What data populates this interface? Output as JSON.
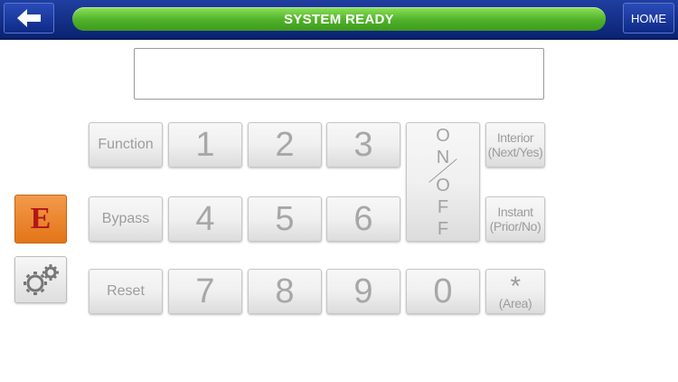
{
  "header": {
    "back_icon": "arrow-left-icon",
    "status": "SYSTEM READY",
    "home_label": "HOME"
  },
  "display": {
    "value": ""
  },
  "keypad": {
    "function": "Function",
    "bypass": "Bypass",
    "reset": "Reset",
    "digits": [
      "1",
      "2",
      "3",
      "4",
      "5",
      "6",
      "7",
      "8",
      "9",
      "0"
    ],
    "onoff": {
      "on": "O\nN",
      "off": "O\nF\nF"
    },
    "interior": {
      "line1": "Interior",
      "line2": "(Next/Yes)"
    },
    "instant": {
      "line1": "Instant",
      "line2": "(Prior/No)"
    },
    "star": {
      "symbol": "*",
      "label": "(Area)"
    }
  },
  "side": {
    "emergency_label": "E",
    "settings_icon": "gears-icon"
  },
  "colors": {
    "topbar": "#0b2372",
    "status_green": "#4eb128",
    "emergency_orange": "#e37518",
    "emergency_text": "#b3161a"
  }
}
